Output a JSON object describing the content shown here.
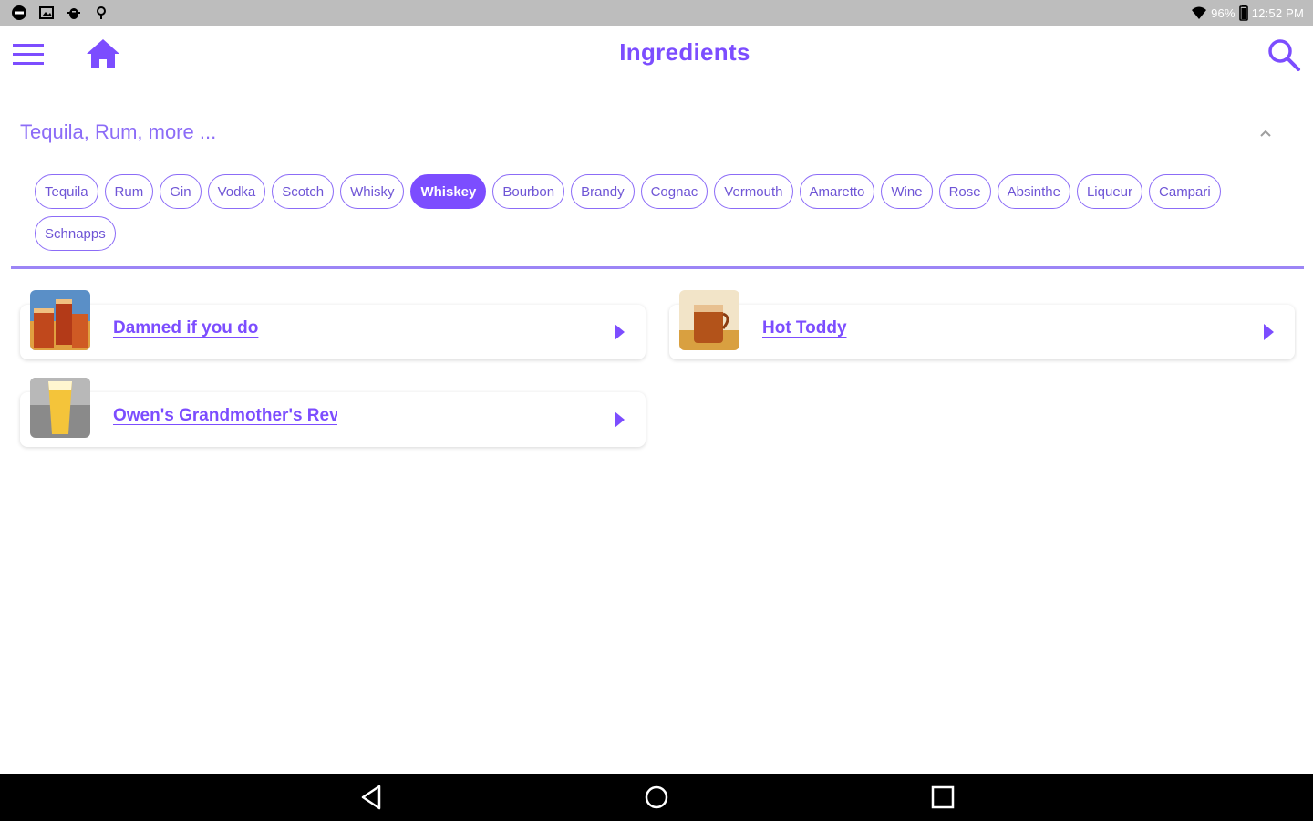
{
  "status_bar": {
    "left_icons": [
      "do-not-disturb-icon",
      "image-icon",
      "android-debug-icon",
      "location-icon"
    ],
    "battery_percent": "96%",
    "time": "12:52 PM",
    "wifi_icon": "wifi-icon",
    "battery_icon": "battery-icon"
  },
  "app_bar": {
    "title": "Ingredients",
    "menu_icon": "hamburger-menu-icon",
    "home_icon": "home-icon",
    "search_icon": "search-icon"
  },
  "filter": {
    "summary": "Tequila, Rum, more ...",
    "collapse_icon": "chevron-up-icon",
    "chips": [
      {
        "label": "Tequila",
        "selected": false
      },
      {
        "label": "Rum",
        "selected": false
      },
      {
        "label": "Gin",
        "selected": false
      },
      {
        "label": "Vodka",
        "selected": false
      },
      {
        "label": "Scotch",
        "selected": false
      },
      {
        "label": "Whisky",
        "selected": false
      },
      {
        "label": "Whiskey",
        "selected": true
      },
      {
        "label": "Bourbon",
        "selected": false
      },
      {
        "label": "Brandy",
        "selected": false
      },
      {
        "label": "Cognac",
        "selected": false
      },
      {
        "label": "Vermouth",
        "selected": false
      },
      {
        "label": "Amaretto",
        "selected": false
      },
      {
        "label": "Wine",
        "selected": false
      },
      {
        "label": "Rose",
        "selected": false
      },
      {
        "label": "Absinthe",
        "selected": false
      },
      {
        "label": "Liqueur",
        "selected": false
      },
      {
        "label": "Campari",
        "selected": false
      },
      {
        "label": "Schnapps",
        "selected": false
      }
    ]
  },
  "results": [
    {
      "title": "Damned if you do",
      "thumbnail": "cocktail-photo-amber-glasses"
    },
    {
      "title": "Hot Toddy",
      "thumbnail": "cocktail-photo-hot-toddy-mug"
    },
    {
      "title": "Owen's Grandmother's Rev",
      "thumbnail": "cocktail-photo-yellow-glass"
    }
  ],
  "nav_bar": {
    "back_icon": "back-triangle-icon",
    "home_icon": "home-circle-icon",
    "recents_icon": "recents-square-icon"
  },
  "colors": {
    "accent": "#7c4dff",
    "chip_text": "#6f55d6",
    "summary_text": "#8c6cf7",
    "status_bar": "#bdbdbd",
    "nav_bar": "#000000"
  }
}
